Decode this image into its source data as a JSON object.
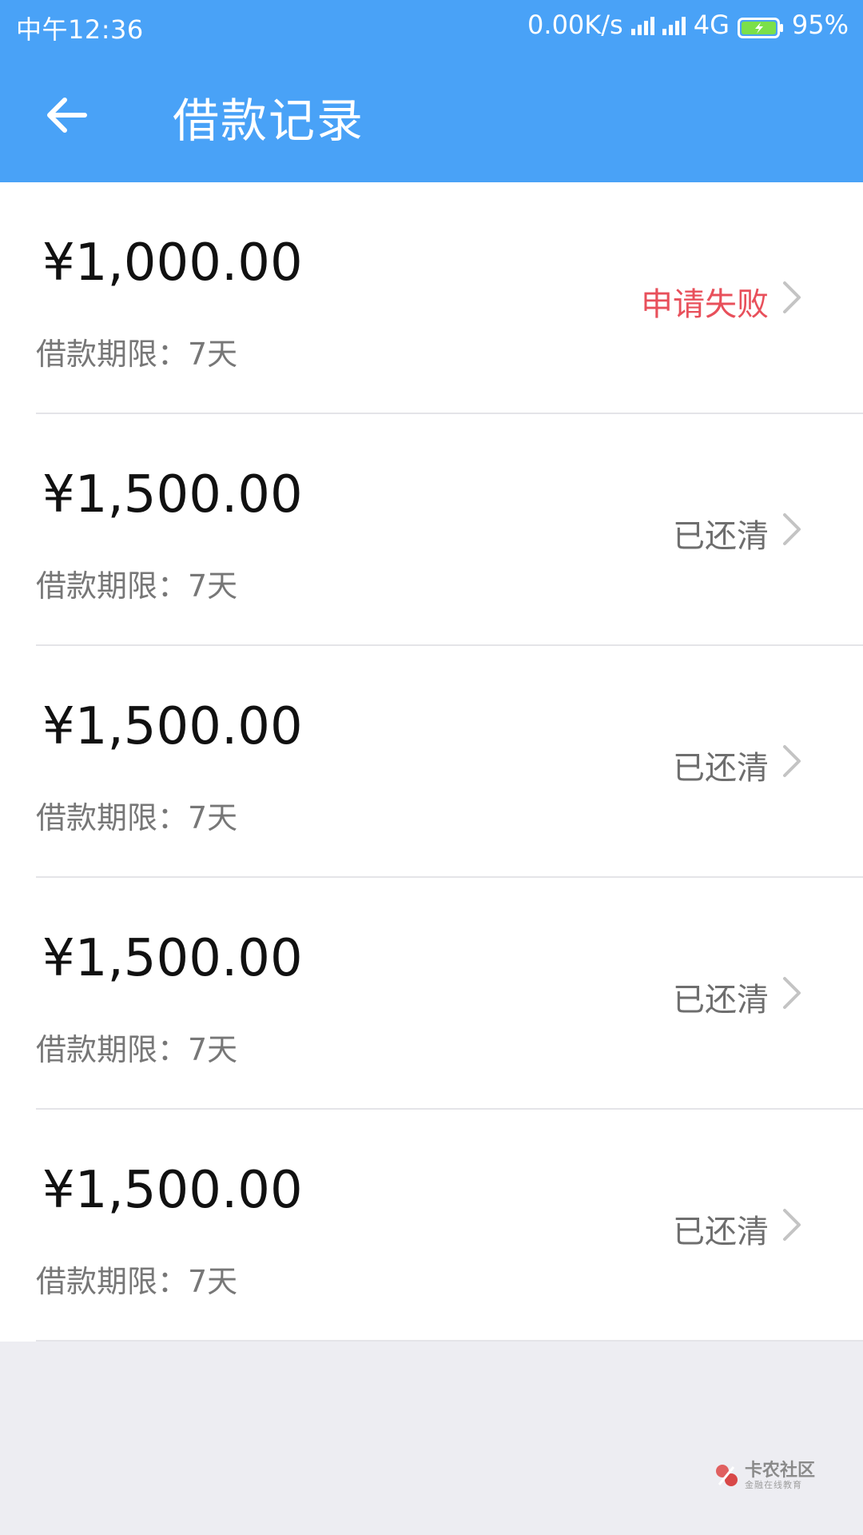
{
  "status_bar": {
    "time": "中午12:36",
    "network_speed": "0.00K/s",
    "network_type": "4G",
    "battery": "95%"
  },
  "header": {
    "title": "借款记录",
    "back_icon": "arrow-left-icon"
  },
  "records": [
    {
      "amount": "¥1,000.00",
      "term": "借款期限：7天",
      "status": "申请失败",
      "status_color": "#e8505b"
    },
    {
      "amount": "¥1,500.00",
      "term": "借款期限：7天",
      "status": "已还清",
      "status_color": "#6e6e6e"
    },
    {
      "amount": "¥1,500.00",
      "term": "借款期限：7天",
      "status": "已还清",
      "status_color": "#6e6e6e"
    },
    {
      "amount": "¥1,500.00",
      "term": "借款期限：7天",
      "status": "已还清",
      "status_color": "#6e6e6e"
    },
    {
      "amount": "¥1,500.00",
      "term": "借款期限：7天",
      "status": "已还清",
      "status_color": "#6e6e6e"
    }
  ],
  "watermark": {
    "title": "卡农社区",
    "subtitle": "金融在线教育"
  },
  "colors": {
    "header_bg": "#49a2f7",
    "page_bg": "#ededf2",
    "failed_status": "#e8505b"
  }
}
